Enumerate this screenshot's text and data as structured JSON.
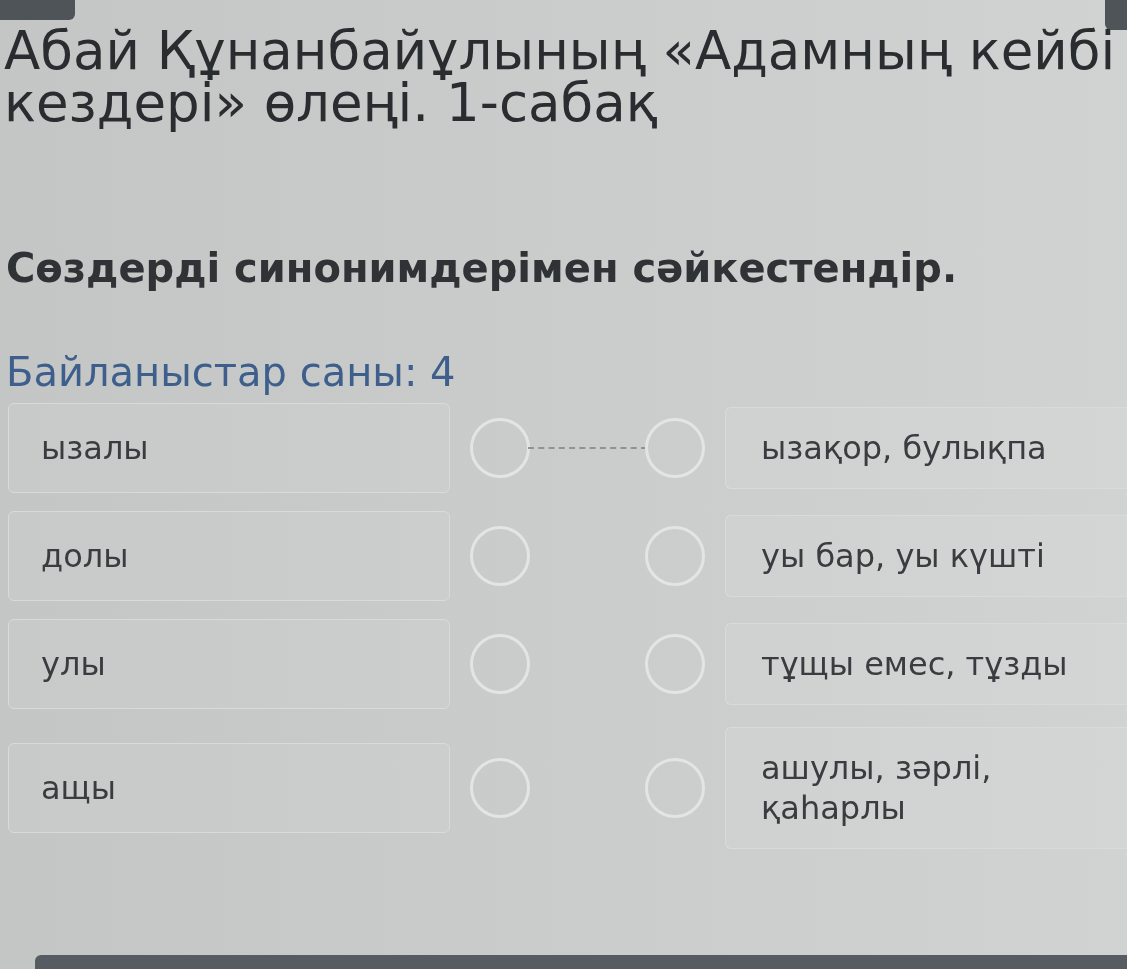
{
  "title_lines": [
    "Абай Құнанбайұлының «Адамның кейбі",
    "кездері» өлеңі. 1-сабақ"
  ],
  "instruction": "Сөздерді синонимдерімен сәйкестендір.",
  "link_count": "Байланыстар саны: 4",
  "pairs": [
    {
      "left": "ызалы",
      "right": "ызақор, булықпа",
      "connected": true
    },
    {
      "left": "долы",
      "right": "уы бар, уы күшті",
      "connected": false
    },
    {
      "left": "улы",
      "right": "тұщы емес, тұзды",
      "connected": false
    },
    {
      "left": "ащы",
      "right": "ашулы, зәрлі, қаһарлы",
      "connected": false
    }
  ]
}
